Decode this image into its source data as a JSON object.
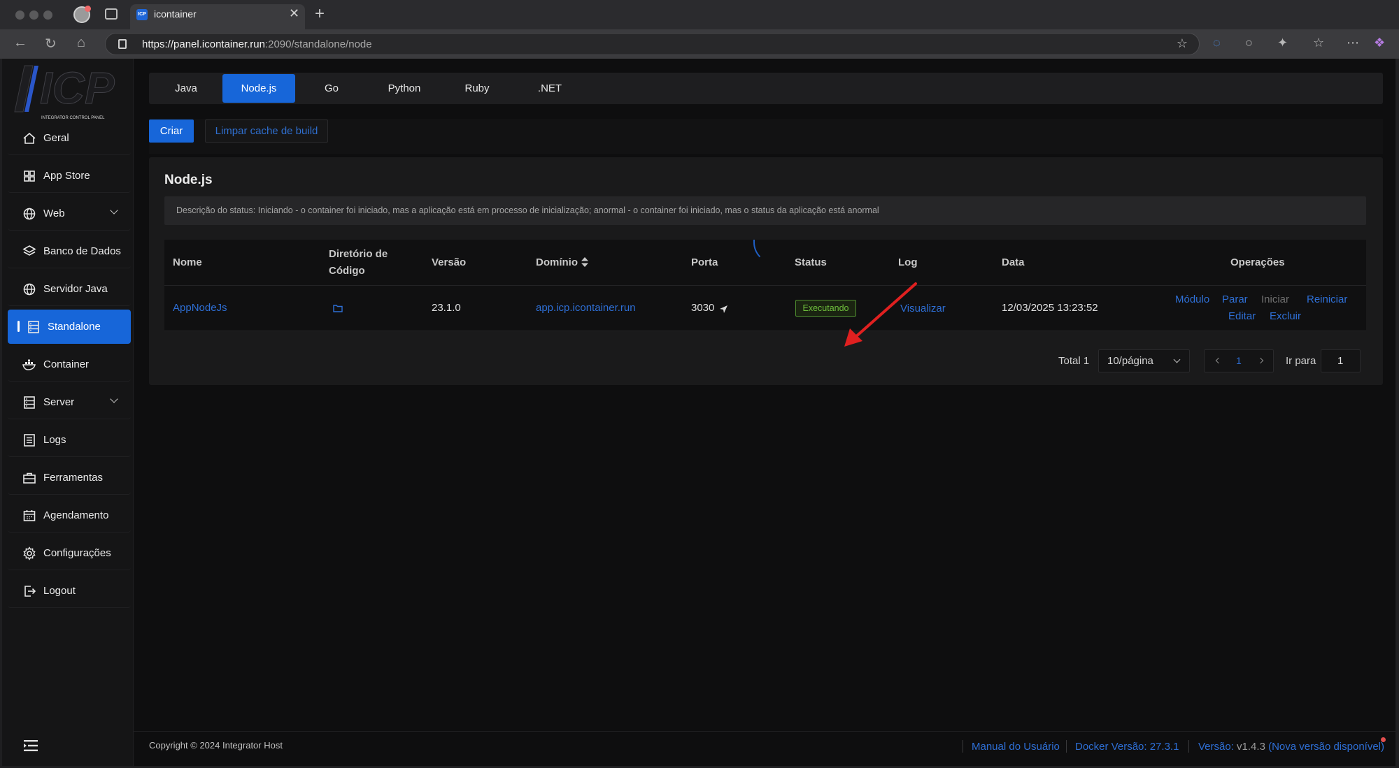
{
  "browser": {
    "tab_title": "icontainer",
    "favicon_text": "ICP",
    "url_host": "https://panel.icontainer.run",
    "url_path": ":2090/standalone/node"
  },
  "sidebar": {
    "logo_text": "ICP",
    "logo_subtext": "INTEGRATOR CONTROL PANEL",
    "items": [
      {
        "label": "Geral",
        "icon": "home-icon"
      },
      {
        "label": "App Store",
        "icon": "grid-icon"
      },
      {
        "label": "Web",
        "icon": "globe-icon",
        "expandable": true
      },
      {
        "label": "Banco de Dados",
        "icon": "layers-icon"
      },
      {
        "label": "Servidor Java",
        "icon": "globe-icon"
      },
      {
        "label": "Standalone",
        "icon": "server-icon",
        "active": true
      },
      {
        "label": "Container",
        "icon": "docker-icon"
      },
      {
        "label": "Server",
        "icon": "server-icon",
        "expandable": true
      },
      {
        "label": "Logs",
        "icon": "list-icon"
      },
      {
        "label": "Ferramentas",
        "icon": "toolbox-icon"
      },
      {
        "label": "Agendamento",
        "icon": "calendar-icon"
      },
      {
        "label": "Configurações",
        "icon": "gear-icon"
      },
      {
        "label": "Logout",
        "icon": "logout-icon"
      }
    ]
  },
  "tabs": [
    {
      "label": "Java"
    },
    {
      "label": "Node.js",
      "active": true
    },
    {
      "label": "Go"
    },
    {
      "label": "Python"
    },
    {
      "label": "Ruby"
    },
    {
      "label": ".NET"
    }
  ],
  "actions": {
    "create_label": "Criar",
    "clear_cache_label": "Limpar cache de build"
  },
  "panel": {
    "title": "Node.js",
    "status_description": "Descrição do status: Iniciando - o container foi iniciado, mas a aplicação está em processo de inicialização; anormal - o container foi iniciado, mas o status da aplicação está anormal"
  },
  "table": {
    "headers": {
      "nome": "Nome",
      "diretorio_line1": "Diretório de",
      "diretorio_line2": "Código",
      "versao": "Versão",
      "dominio": "Domínio",
      "porta": "Porta",
      "status": "Status",
      "log": "Log",
      "data": "Data",
      "operacoes": "Operações"
    },
    "rows": [
      {
        "nome": "AppNodeJs",
        "versao": "23.1.0",
        "dominio": "app.icp.icontainer.run",
        "porta": "3030",
        "status": "Executando",
        "log": "Visualizar",
        "data": "12/03/2025 13:23:52",
        "ops": {
          "modulo": "Módulo",
          "parar": "Parar",
          "iniciar": "Iniciar",
          "reiniciar": "Reiniciar",
          "editar": "Editar",
          "excluir": "Excluir"
        }
      }
    ]
  },
  "pagination": {
    "total_label": "Total 1",
    "page_size": "10/página",
    "current_page": "1",
    "goto_label": "Ir para",
    "goto_value": "1"
  },
  "footer": {
    "copyright": "Copyright © 2024 Integrator Host",
    "manual": "Manual do Usuário",
    "docker_version": "Docker Versão: 27.3.1",
    "version_label": "Versão:",
    "version_value": "v1.4.3",
    "new_version": "(Nova versão disponível)"
  },
  "colors": {
    "accent": "#1766d9",
    "link": "#2e6fd6",
    "status_running": "#6fbf3d",
    "annotation_arrow": "#e02020"
  }
}
